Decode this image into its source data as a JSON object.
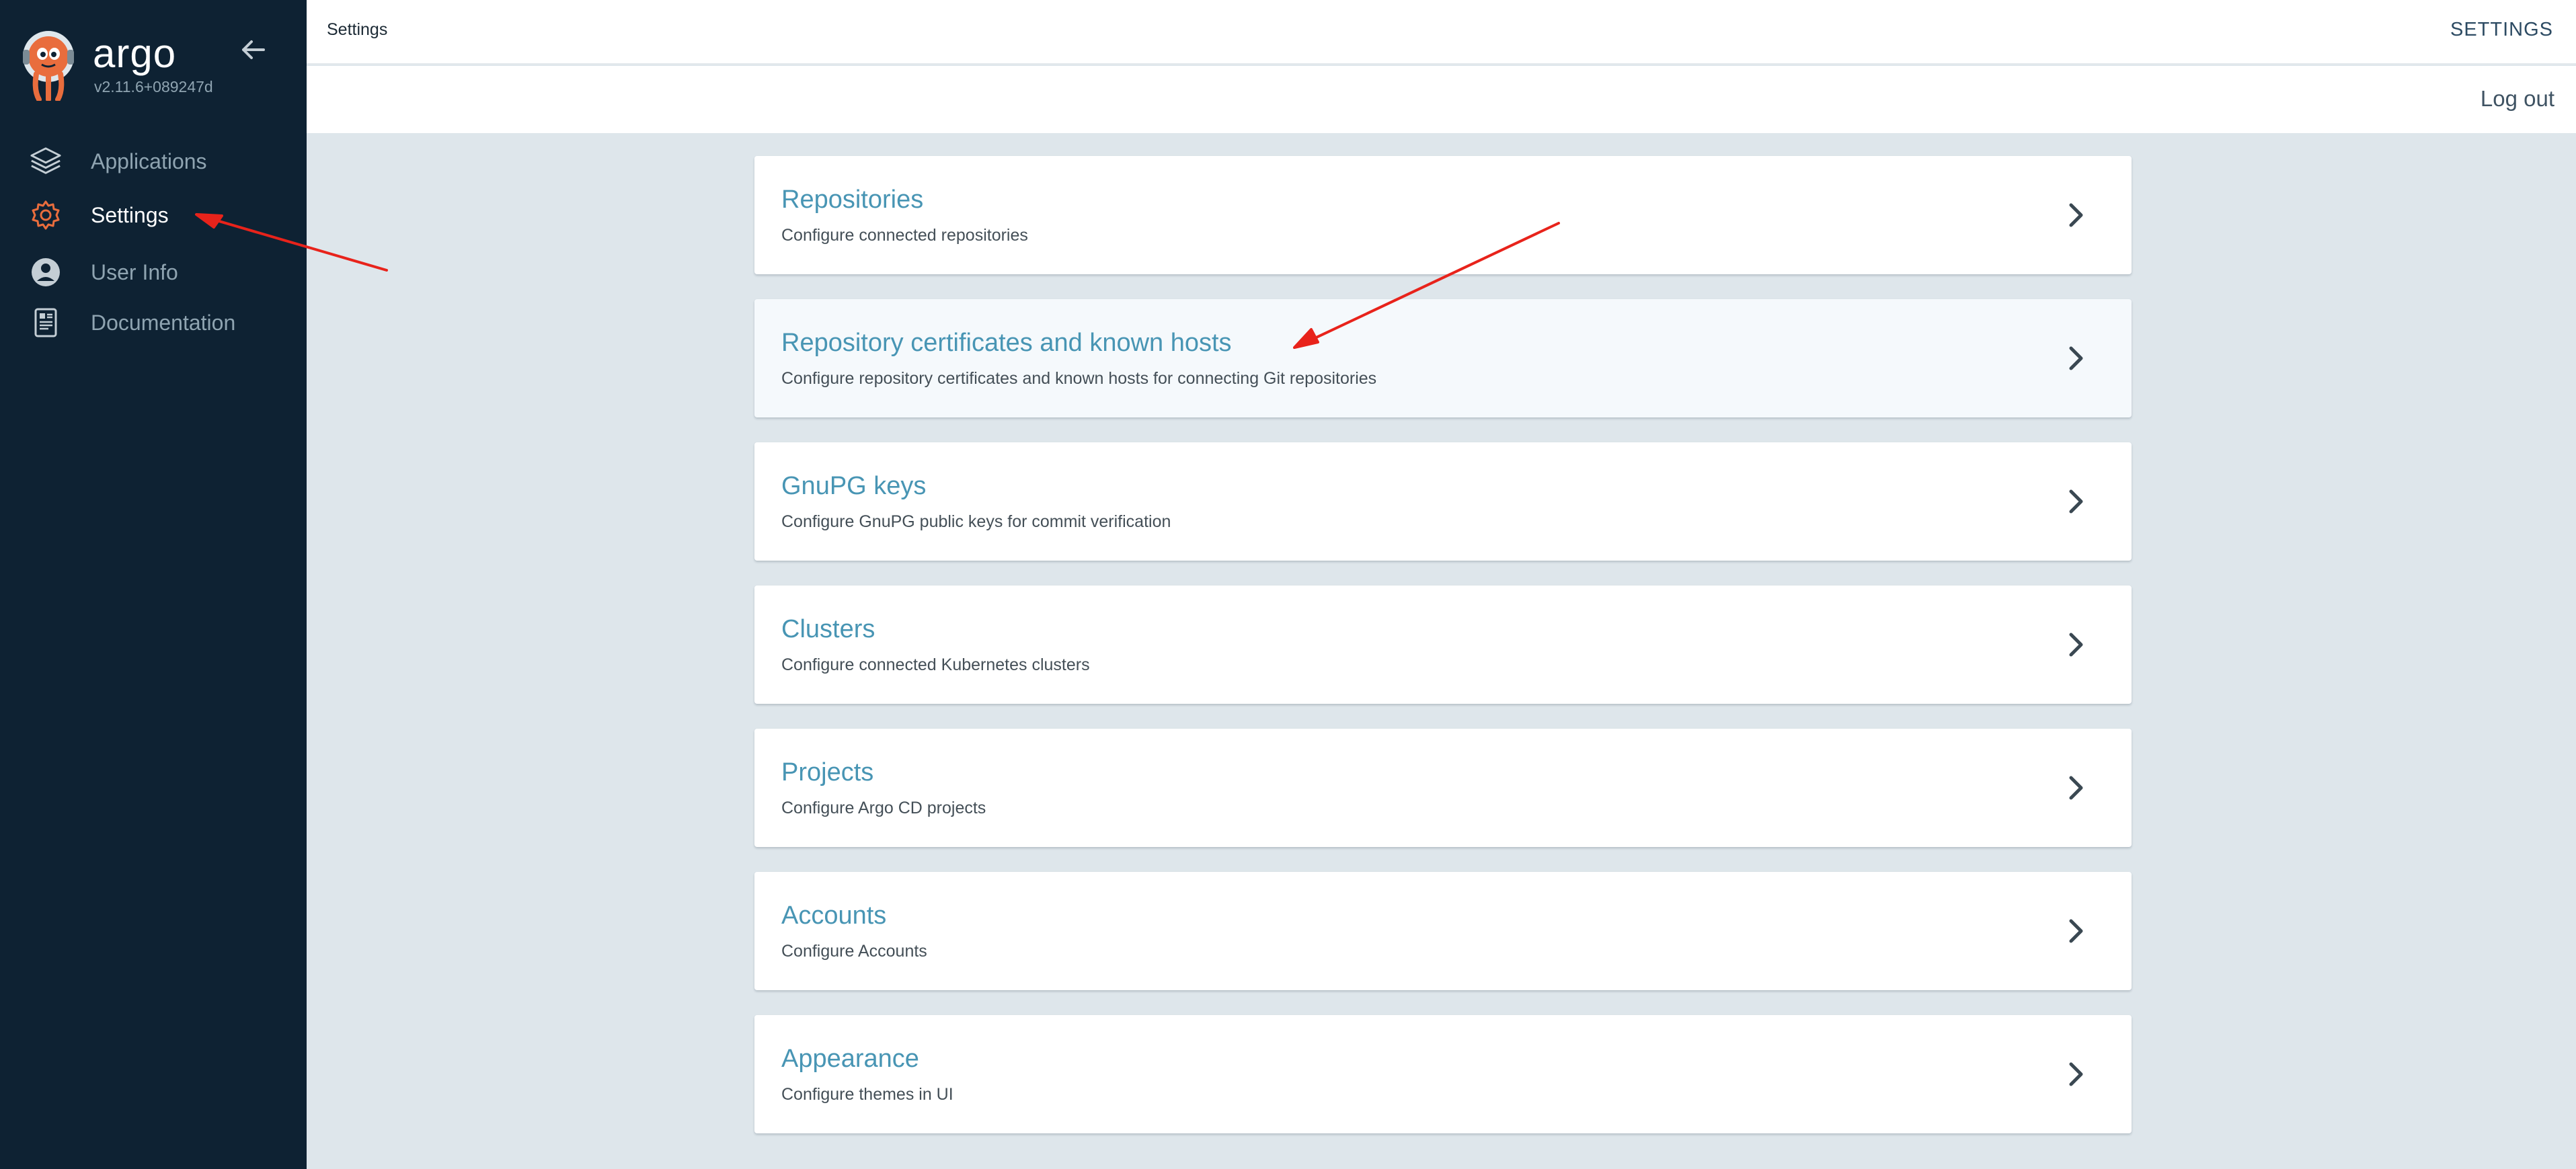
{
  "brand": {
    "name": "argo",
    "version": "v2.11.6+089247d"
  },
  "sidebar": {
    "items": [
      {
        "label": "Applications",
        "icon": "layers-icon"
      },
      {
        "label": "Settings",
        "icon": "gear-icon",
        "active": true
      },
      {
        "label": "User Info",
        "icon": "user-icon"
      },
      {
        "label": "Documentation",
        "icon": "documentation-icon"
      }
    ]
  },
  "topbar": {
    "breadcrumb": "Settings",
    "title": "SETTINGS",
    "logout": "Log out"
  },
  "settings": {
    "items": [
      {
        "title": "Repositories",
        "description": "Configure connected repositories"
      },
      {
        "title": "Repository certificates and known hosts",
        "description": "Configure repository certificates and known hosts for connecting Git repositories"
      },
      {
        "title": "GnuPG keys",
        "description": "Configure GnuPG public keys for commit verification"
      },
      {
        "title": "Clusters",
        "description": "Configure connected Kubernetes clusters"
      },
      {
        "title": "Projects",
        "description": "Configure Argo CD projects"
      },
      {
        "title": "Accounts",
        "description": "Configure Accounts"
      },
      {
        "title": "Appearance",
        "description": "Configure themes in UI"
      }
    ]
  },
  "colors": {
    "sidebar_bg": "#0e2233",
    "accent": "#4895b4",
    "active_icon": "#e96d3d",
    "annotation_arrow": "#e8231b"
  }
}
